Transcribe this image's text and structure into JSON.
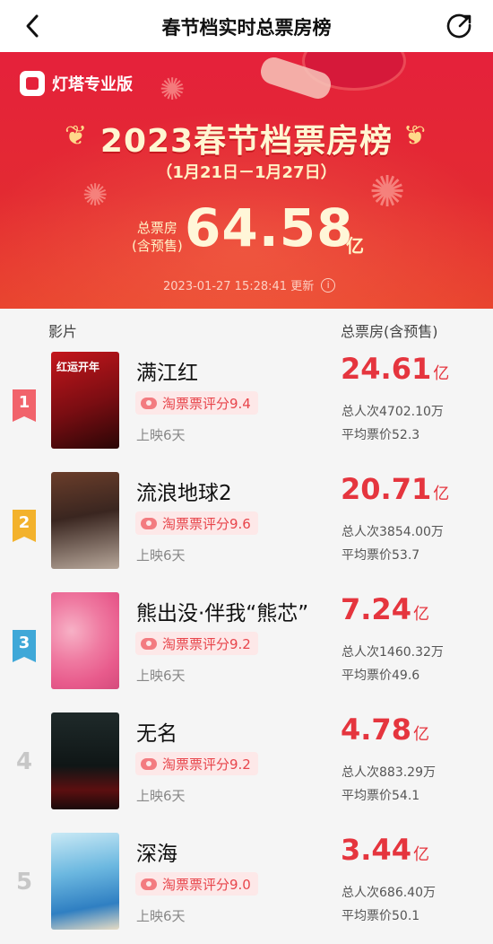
{
  "nav": {
    "title": "春节档实时总票房榜",
    "back_icon": "chevron-left-icon",
    "share_icon": "share-icon"
  },
  "banner": {
    "brand_name": "灯塔专业版",
    "headline": "2023春节档票房榜",
    "period": "（1月21日－1月27日）",
    "total_label_line1": "总票房",
    "total_label_line2": "(含预售)",
    "total_value": "64.58",
    "total_unit": "亿",
    "updated": "2023-01-27 15:28:41 更新",
    "accent_color": "#e5213b"
  },
  "list": {
    "header_film": "影片",
    "header_box": "总票房(含预售)",
    "items": [
      {
        "rank": "1",
        "name": "满江红",
        "poster_text": "红运开年",
        "rating": "淘票票评分9.4",
        "days": "上映6天",
        "box_value": "24.61",
        "box_unit": "亿",
        "persons": "总人次4702.10万",
        "avg_price": "平均票价52.3"
      },
      {
        "rank": "2",
        "name": "流浪地球2",
        "poster_text": "",
        "rating": "淘票票评分9.6",
        "days": "上映6天",
        "box_value": "20.71",
        "box_unit": "亿",
        "persons": "总人次3854.00万",
        "avg_price": "平均票价53.7"
      },
      {
        "rank": "3",
        "name": "熊出没·伴我“熊芯”",
        "poster_text": "",
        "rating": "淘票票评分9.2",
        "days": "上映6天",
        "box_value": "7.24",
        "box_unit": "亿",
        "persons": "总人次1460.32万",
        "avg_price": "平均票价49.6"
      },
      {
        "rank": "4",
        "name": "无名",
        "poster_text": "",
        "rating": "淘票票评分9.2",
        "days": "上映6天",
        "box_value": "4.78",
        "box_unit": "亿",
        "persons": "总人次883.29万",
        "avg_price": "平均票价54.1"
      },
      {
        "rank": "5",
        "name": "深海",
        "poster_text": "",
        "rating": "淘票票评分9.0",
        "days": "上映6天",
        "box_value": "3.44",
        "box_unit": "亿",
        "persons": "总人次686.40万",
        "avg_price": "平均票价50.1"
      }
    ]
  }
}
